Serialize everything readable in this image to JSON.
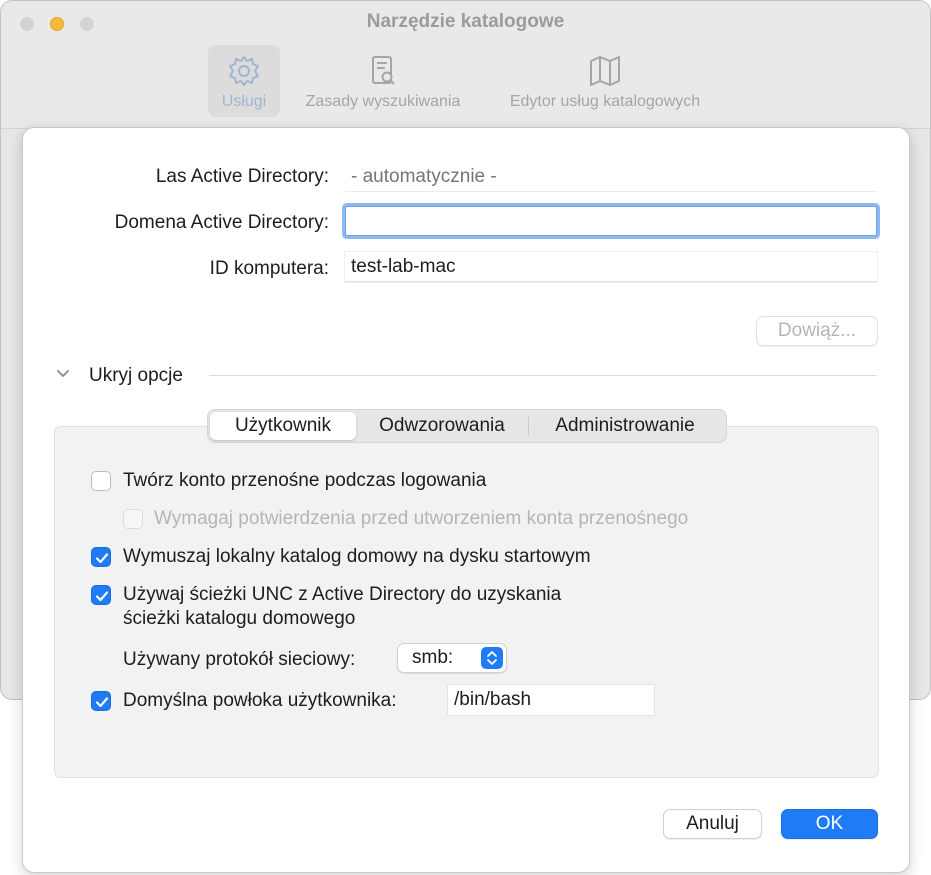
{
  "window": {
    "title": "Narzędzie katalogowe",
    "toolbar": [
      {
        "label": "Usługi",
        "icon": "gear-icon",
        "selected": true
      },
      {
        "label": "Zasady wyszukiwania",
        "icon": "search-document-icon",
        "selected": false
      },
      {
        "label": "Edytor usług katalogowych",
        "icon": "map-icon",
        "selected": false
      }
    ]
  },
  "form": {
    "forest_label": "Las Active Directory:",
    "forest_placeholder": "- automatycznie -",
    "domain_label": "Domena Active Directory:",
    "domain_value": "",
    "computer_id_label": "ID komputera:",
    "computer_id_value": "test-lab-mac",
    "bind_button": "Dowiąż..."
  },
  "options": {
    "toggle_label": "Ukryj opcje",
    "tabs": [
      {
        "label": "Użytkownik",
        "active": true
      },
      {
        "label": "Odwzorowania",
        "active": false
      },
      {
        "label": "Administrowanie",
        "active": false
      }
    ],
    "mobile_account": {
      "label": "Twórz konto przenośne podczas logowania",
      "checked": false
    },
    "require_confirmation": {
      "label": "Wymagaj potwierdzenia przed utworzeniem konta przenośnego",
      "checked": false,
      "enabled": false
    },
    "force_local_home": {
      "label": "Wymuszaj lokalny katalog domowy na dysku startowym",
      "checked": true
    },
    "use_unc": {
      "label_line1": "Używaj ścieżki UNC z Active Directory do uzyskania",
      "label_line2": "ścieżki katalogu domowego",
      "checked": true
    },
    "protocol_label": "Używany protokół sieciowy:",
    "protocol_value": "smb:",
    "default_shell": {
      "label": "Domyślna powłoka użytkownika:",
      "checked": true,
      "value": "/bin/bash"
    }
  },
  "buttons": {
    "cancel": "Anuluj",
    "ok": "OK"
  },
  "colors": {
    "accent": "#1f7cf6",
    "focus_ring": "#8fb8f1"
  }
}
